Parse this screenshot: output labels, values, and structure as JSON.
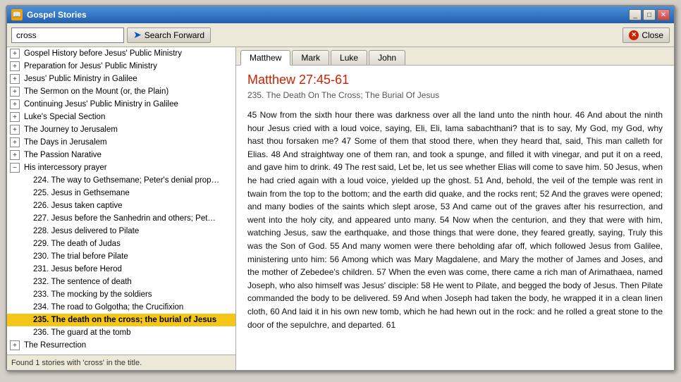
{
  "window": {
    "title": "Gospel Stories",
    "icon": "📖"
  },
  "toolbar": {
    "search_value": "cross",
    "search_placeholder": "cross",
    "search_forward_label": "Search Forward",
    "close_label": "Close"
  },
  "tabs": [
    {
      "label": "Matthew",
      "active": true
    },
    {
      "label": "Mark",
      "active": false
    },
    {
      "label": "Luke",
      "active": false
    },
    {
      "label": "John",
      "active": false
    }
  ],
  "passage": {
    "title": "Matthew 27:45-61",
    "subtitle": "235. The Death On The Cross; The Burial Of Jesus",
    "text": "45 Now from the sixth hour there was darkness over all the land unto the ninth hour. 46 And about the ninth hour Jesus cried with a loud voice, saying, Eli, Eli, lama sabachthani? that is to say, My God, my God, why hast thou forsaken me? 47 Some of them that stood there, when they heard that, said, This man calleth for Elias. 48 And straightway one of them ran, and took a spunge, and filled it with vinegar, and put it on a reed, and gave him to drink. 49 The rest said, Let be, let us see whether Elias will come to save him. 50 Jesus, when he had cried again with a loud voice, yielded up the ghost. 51 And, behold, the veil of the temple was rent in twain from the top to the bottom; and the earth did quake, and the rocks rent; 52 And the graves were opened; and many bodies of the saints which slept arose, 53 And came out of the graves after his resurrection, and went into the holy city, and appeared unto many. 54 Now when the centurion, and they that were with him, watching Jesus, saw the earthquake, and those things that were done, they feared greatly, saying, Truly this was the Son of God. 55 And many women were there beholding afar off, which followed Jesus from Galilee, ministering unto him: 56 Among which was Mary Magdalene, and Mary the mother of James and Joses, and the mother of Zebedee's children. 57 When the even was come, there came a rich man of Arimathaea, named Joseph, who also himself was Jesus' disciple: 58 He went to Pilate, and begged the body of Jesus. Then Pilate commanded the body to be delivered. 59 And when Joseph had taken the body, he wrapped it in a clean linen cloth, 60 And laid it in his own new tomb, which he had hewn out in the rock: and he rolled a great stone to the door of the sepulchre, and departed. 61"
  },
  "tree": {
    "items": [
      {
        "label": "Gospel History before Jesus' Public Ministry",
        "type": "parent",
        "expanded": false,
        "indent": 0
      },
      {
        "label": "Preparation for Jesus' Public Ministry",
        "type": "parent",
        "expanded": false,
        "indent": 0
      },
      {
        "label": "Jesus' Public Ministry in Galilee",
        "type": "parent",
        "expanded": false,
        "indent": 0
      },
      {
        "label": "The Sermon on the Mount (or, the Plain)",
        "type": "parent",
        "expanded": false,
        "indent": 0
      },
      {
        "label": "Continuing Jesus' Public Ministry in Galilee",
        "type": "parent",
        "expanded": false,
        "indent": 0
      },
      {
        "label": "Luke's Special Section",
        "type": "parent",
        "expanded": false,
        "indent": 0
      },
      {
        "label": "The Journey to Jerusalem",
        "type": "parent",
        "expanded": false,
        "indent": 0
      },
      {
        "label": "The Days in Jerusalem",
        "type": "parent",
        "expanded": false,
        "indent": 0
      },
      {
        "label": "The Passion Narative",
        "type": "parent",
        "expanded": false,
        "indent": 0
      },
      {
        "label": "His intercessory prayer",
        "type": "parent",
        "expanded": true,
        "indent": 0
      },
      {
        "label": "224. The way to Gethsemane; Peter's denial prop…",
        "type": "child",
        "indent": 1
      },
      {
        "label": "225. Jesus in Gethsemane",
        "type": "child",
        "indent": 1
      },
      {
        "label": "226. Jesus taken captive",
        "type": "child",
        "indent": 1
      },
      {
        "label": "227. Jesus before the Sanhedrin and others; Pet…",
        "type": "child",
        "indent": 1
      },
      {
        "label": "228. Jesus delivered to Pilate",
        "type": "child",
        "indent": 1
      },
      {
        "label": "229. The death of Judas",
        "type": "child",
        "indent": 1
      },
      {
        "label": "230. The trial before Pilate",
        "type": "child",
        "indent": 1
      },
      {
        "label": "231. Jesus before Herod",
        "type": "child",
        "indent": 1
      },
      {
        "label": "232. The sentence of death",
        "type": "child",
        "indent": 1
      },
      {
        "label": "233. The mocking by the soldiers",
        "type": "child",
        "indent": 1
      },
      {
        "label": "234. The road to Golgotha; the Crucifixion",
        "type": "child",
        "indent": 1
      },
      {
        "label": "235. The death on the cross; the burial of Jesus",
        "type": "child",
        "indent": 1,
        "selected": true
      },
      {
        "label": "236. The guard at the tomb",
        "type": "child",
        "indent": 1
      },
      {
        "label": "The Resurrection",
        "type": "parent",
        "expanded": false,
        "indent": 0
      }
    ]
  },
  "status": {
    "text": "Found 1 stories with 'cross' in the title."
  }
}
